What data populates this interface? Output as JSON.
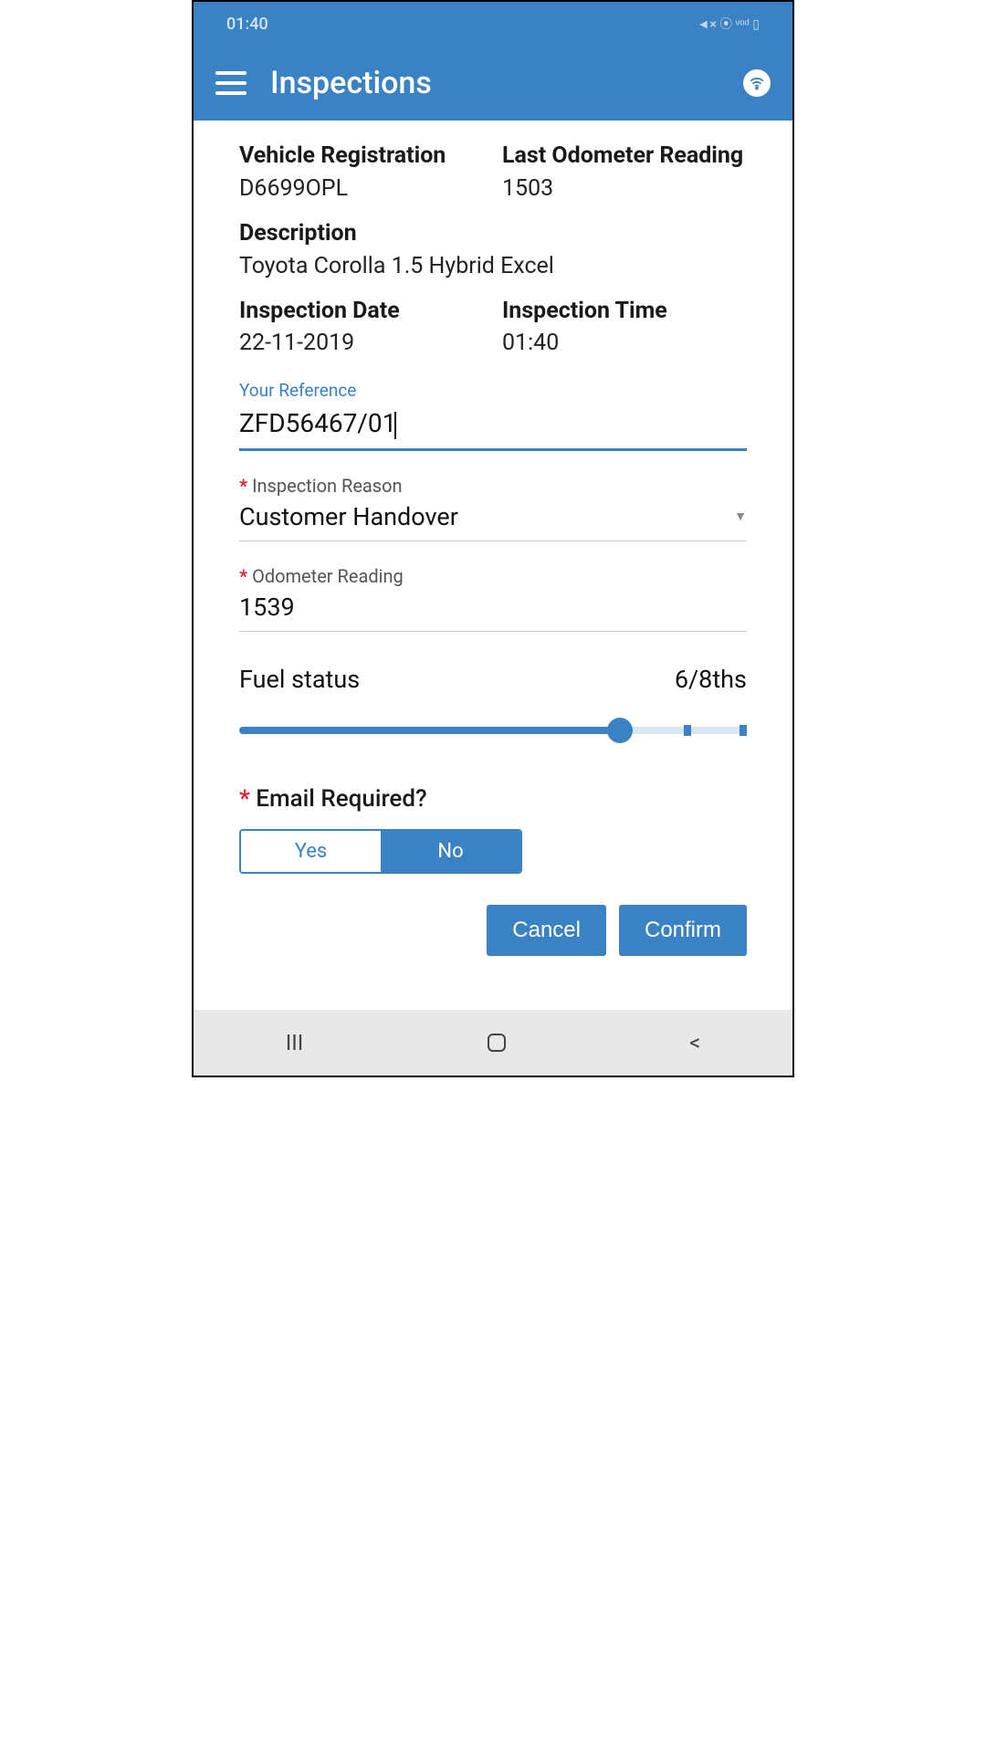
{
  "status": {
    "time": "01:40",
    "indicators": "◄× ⦿ ᵛᵒᵈ ▯"
  },
  "header": {
    "title": "Inspections"
  },
  "vehicle": {
    "reg_label": "Vehicle Registration",
    "reg_value": "D6699OPL",
    "odom_label": "Last Odometer Reading",
    "odom_value": "1503",
    "desc_label": "Description",
    "desc_value": "Toyota Corolla 1.5 Hybrid Excel",
    "date_label": "Inspection Date",
    "date_value": "22-11-2019",
    "time_label": "Inspection Time",
    "time_value": "01:40"
  },
  "form": {
    "reference_label": "Your Reference",
    "reference_value": "ZFD56467/01",
    "reason_label": "Inspection Reason",
    "reason_value": "Customer Handover",
    "odom_label": "Odometer Reading",
    "odom_value": "1539",
    "fuel_label": "Fuel status",
    "fuel_value": "6/8ths",
    "fuel_fraction": 0.75,
    "email_label": "Email Required?",
    "email_yes": "Yes",
    "email_no": "No",
    "email_selected": "No"
  },
  "actions": {
    "cancel": "Cancel",
    "confirm": "Confirm"
  },
  "colors": {
    "accent": "#3b82c4"
  }
}
